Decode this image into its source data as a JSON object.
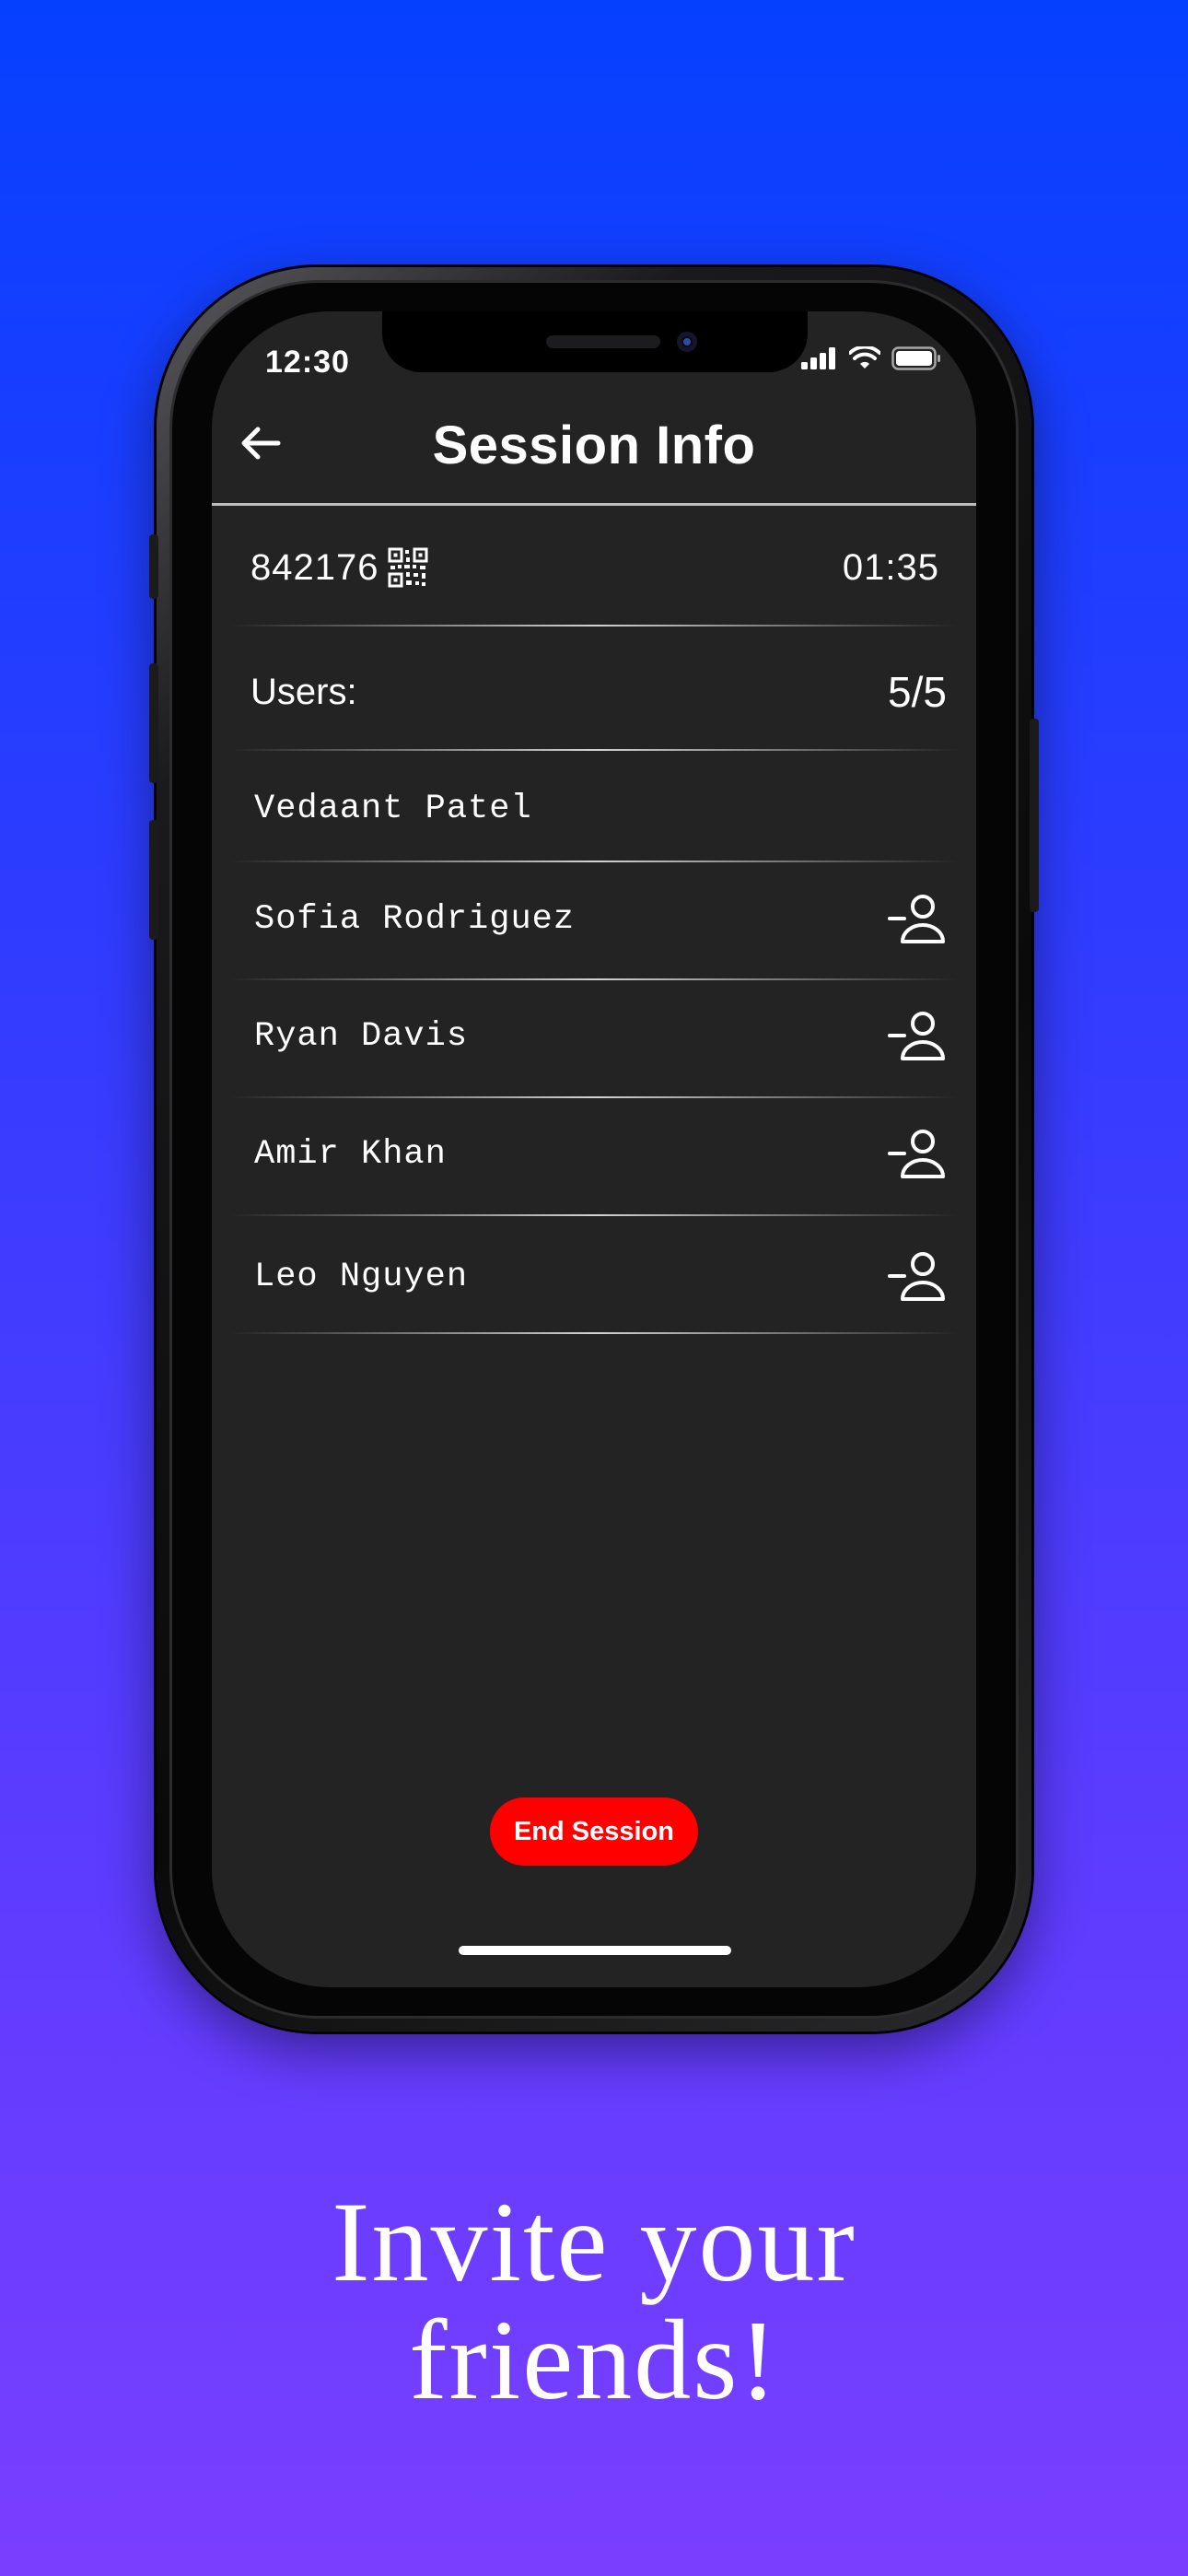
{
  "status_bar": {
    "time": "12:30"
  },
  "header": {
    "title": "Session Info"
  },
  "session": {
    "code": "842176",
    "timer": "01:35"
  },
  "users": {
    "label": "Users:",
    "count": "5/5",
    "list": [
      {
        "name": "Vedaant Patel",
        "removable": false
      },
      {
        "name": "Sofia Rodriguez",
        "removable": true
      },
      {
        "name": "Ryan Davis",
        "removable": true
      },
      {
        "name": "Amir Khan",
        "removable": true
      },
      {
        "name": "Leo Nguyen",
        "removable": true
      }
    ]
  },
  "actions": {
    "end_session_label": "End Session",
    "end_session_color": "#ff0000"
  },
  "promo": {
    "line1": "Invite your",
    "line2": "friends!"
  },
  "icons": [
    "back-arrow-icon",
    "qr-code-icon",
    "signal-icon",
    "wifi-icon",
    "battery-icon",
    "remove-user-icon"
  ],
  "colors": {
    "screen_bg": "#232323",
    "bg_top": "#0640ff",
    "bg_bottom": "#7a3eff"
  }
}
